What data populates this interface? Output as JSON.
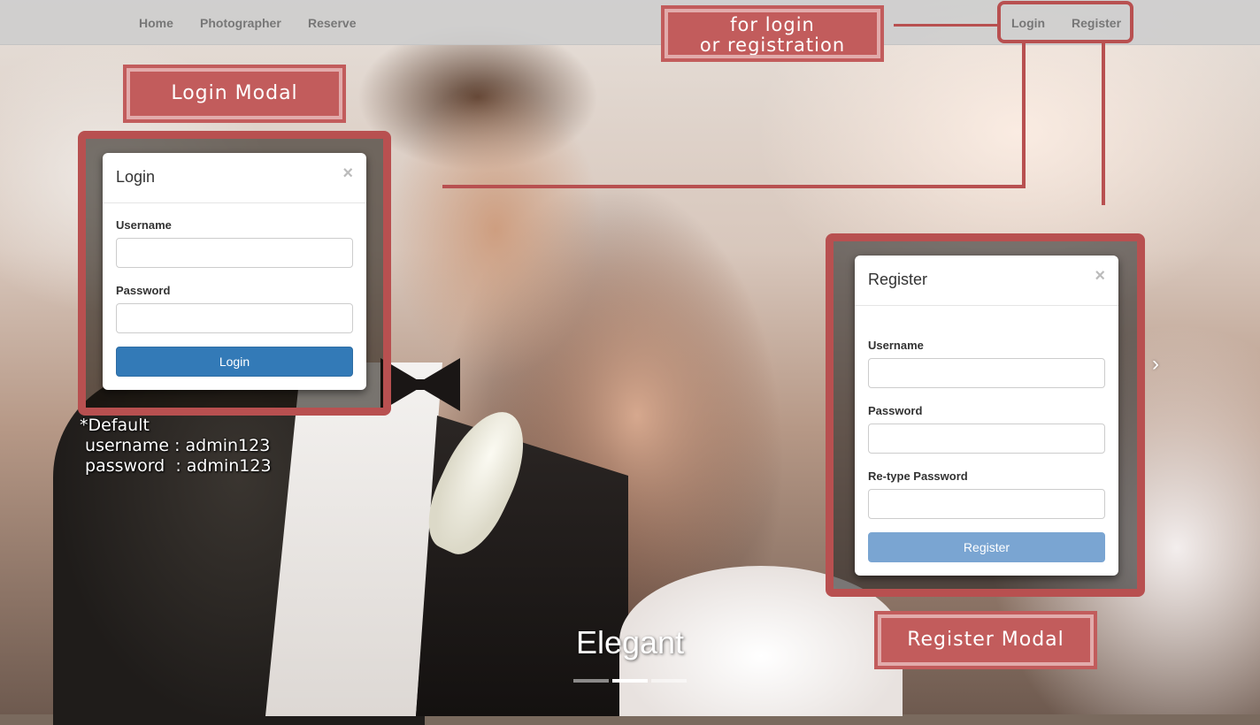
{
  "navbar": {
    "left_links": [
      "Home",
      "Photographer",
      "Reserve"
    ],
    "right_links": [
      "Login",
      "Register"
    ]
  },
  "annotations": {
    "login_registration": "for login\nor registration",
    "login_modal": "Login Modal",
    "register_modal": "Register Modal",
    "default_note": "*Default\n username : admin123\n password  : admin123"
  },
  "login_modal": {
    "title": "Login",
    "close": "×",
    "username_label": "Username",
    "password_label": "Password",
    "submit_label": "Login"
  },
  "register_modal": {
    "title": "Register",
    "close": "×",
    "username_label": "Username",
    "password_label": "Password",
    "retype_label": "Re-type Password",
    "submit_label": "Register"
  },
  "carousel": {
    "caption": "Elegant",
    "next_icon": "chevron-right-icon",
    "next_glyph": "›",
    "slides": 3,
    "active_slide": 2
  },
  "colors": {
    "annotation": "#c25c5c",
    "primary_button": "#337ab7",
    "primary_button_disabled": "#7aa5d2"
  }
}
